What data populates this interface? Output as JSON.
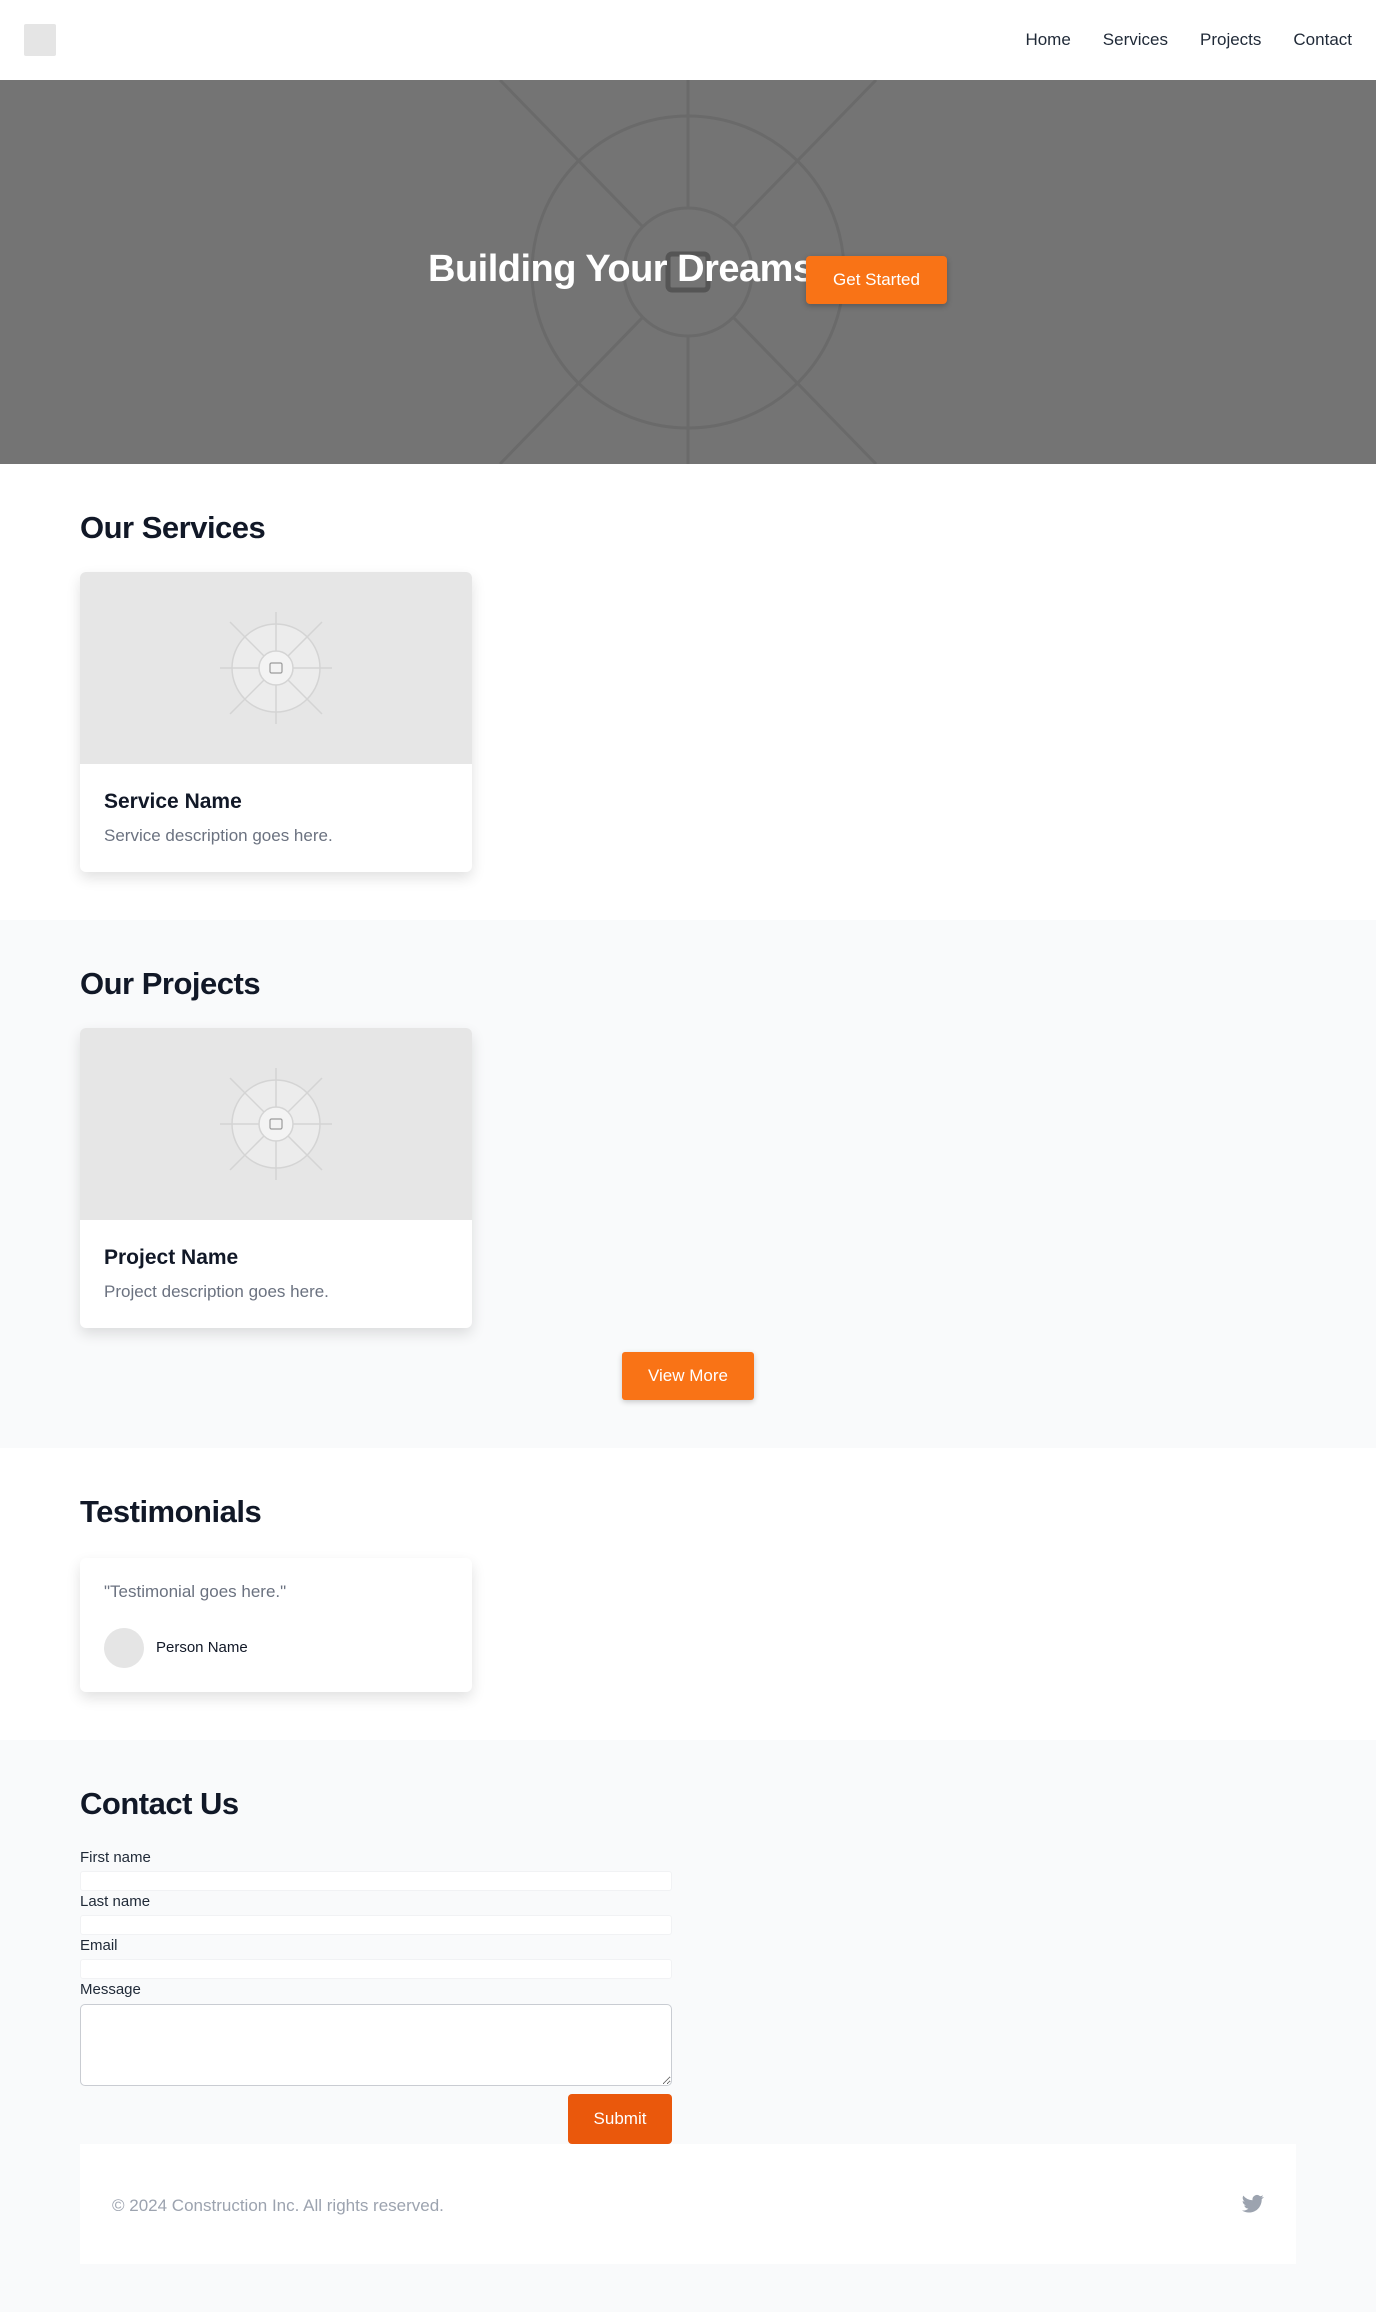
{
  "header": {
    "nav": [
      "Home",
      "Services",
      "Projects",
      "Contact"
    ]
  },
  "hero": {
    "title": "Building Your Dreams",
    "cta": "Get Started"
  },
  "services": {
    "title": "Our Services",
    "card": {
      "name": "Service Name",
      "description": "Service description goes here."
    }
  },
  "projects": {
    "title": "Our Projects",
    "card": {
      "name": "Project Name",
      "description": "Project description goes here."
    },
    "view_more": "View More"
  },
  "testimonials": {
    "title": "Testimonials",
    "quote": "\"Testimonial goes here.\"",
    "person": "Person Name"
  },
  "contact": {
    "title": "Contact Us",
    "fields": [
      "First name",
      "Last name",
      "Email",
      "Message"
    ],
    "submit": "Submit"
  },
  "footer": {
    "copyright": "© 2024 Construction Inc. All rights reserved.",
    "social_icon": "twitter-icon"
  },
  "colors": {
    "accent": "#f97316",
    "submit": "#ea580c",
    "hero_bg": "#747474"
  }
}
